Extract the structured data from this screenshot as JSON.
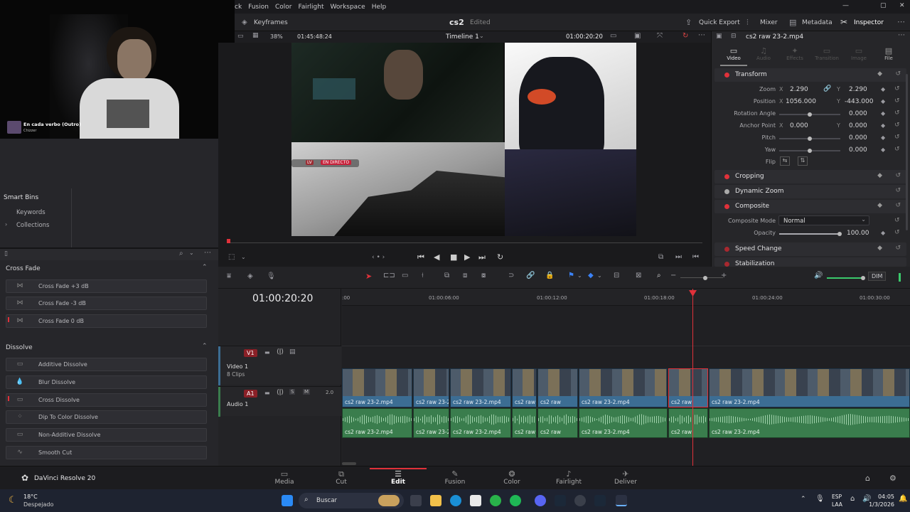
{
  "menu": {
    "items": [
      "ck",
      "Fusion",
      "Color",
      "Fairlight",
      "Workspace",
      "Help"
    ]
  },
  "topbar": {
    "keyframes": "Keyframes",
    "project": "cs2",
    "status": "Edited",
    "quick_export": "Quick Export",
    "mixer": "Mixer",
    "metadata": "Metadata",
    "inspector": "Inspector"
  },
  "viewer_bar": {
    "zoom": "38%",
    "source_tc": "01:45:48:24",
    "timeline_name": "Timeline 1",
    "record_tc": "01:00:20:20"
  },
  "webcam": {
    "song_title": "En cada verbo (Outro)",
    "song_artist": "Chizzer",
    "overlay_live": "LV",
    "overlay_en_directo": "EN DIRECTO"
  },
  "media_pool": {
    "smart_bins": "Smart Bins",
    "keywords": "Keywords",
    "collections": "Collections"
  },
  "effects": {
    "cross_fade_header": "Cross Fade",
    "cross_fades": [
      "Cross Fade +3 dB",
      "Cross Fade -3 dB",
      "Cross Fade 0 dB"
    ],
    "dissolve_header": "Dissolve",
    "dissolves": [
      "Additive Dissolve",
      "Blur Dissolve",
      "Cross Dissolve",
      "Dip To Color Dissolve",
      "Non-Additive Dissolve",
      "Smooth Cut"
    ]
  },
  "inspector": {
    "clip_name": "cs2 raw 23-2.mp4",
    "tabs": [
      "Video",
      "Audio",
      "Effects",
      "Transition",
      "Image",
      "File"
    ],
    "transform": "Transform",
    "zoom_label": "Zoom",
    "zoom_x": "2.290",
    "zoom_y": "2.290",
    "position_label": "Position",
    "position_x": "1056.000",
    "position_y": "-443.000",
    "rotation_label": "Rotation Angle",
    "rotation": "0.000",
    "anchor_label": "Anchor Point",
    "anchor_x": "0.000",
    "anchor_y": "0.000",
    "pitch_label": "Pitch",
    "pitch": "0.000",
    "yaw_label": "Yaw",
    "yaw": "0.000",
    "flip_label": "Flip",
    "x_axis": "X",
    "y_axis": "Y",
    "cropping": "Cropping",
    "dynamic_zoom": "Dynamic Zoom",
    "composite": "Composite",
    "composite_mode_label": "Composite Mode",
    "composite_mode": "Normal",
    "opacity_label": "Opacity",
    "opacity": "100.00",
    "speed_change": "Speed Change",
    "stabilization": "Stabilization"
  },
  "timeline": {
    "timecode": "01:00:20:20",
    "ticks": [
      ":00",
      "01:00:06:00",
      "01:00:12:00",
      "01:00:18:00",
      "01:00:24:00",
      "01:00:30:00"
    ],
    "dim": "DIM",
    "v1": "V1",
    "video_track": "Video 1",
    "video_clips": "8 Clips",
    "a1": "A1",
    "audio_track": "Audio 1",
    "audio_level": "2.0",
    "solo": "S",
    "mute": "M",
    "clip_name": "cs2 raw 23-2.mp4",
    "clip_name_short": "cs2 raw"
  },
  "pages": {
    "app": "DaVinci Resolve 20",
    "items": [
      "Media",
      "Cut",
      "Edit",
      "Fusion",
      "Color",
      "Fairlight",
      "Deliver"
    ],
    "active": "Edit"
  },
  "taskbar": {
    "temp": "18°C",
    "weather": "Despejado",
    "search": "Buscar",
    "lang1": "ESP",
    "lang2": "LAA",
    "time": "04:05",
    "date": "1/3/2026"
  },
  "colors": {
    "accent": "#e0313a",
    "video_clip": "#3c6d93",
    "audio_clip": "#3a7d4d",
    "playhead": "#e0313a"
  }
}
